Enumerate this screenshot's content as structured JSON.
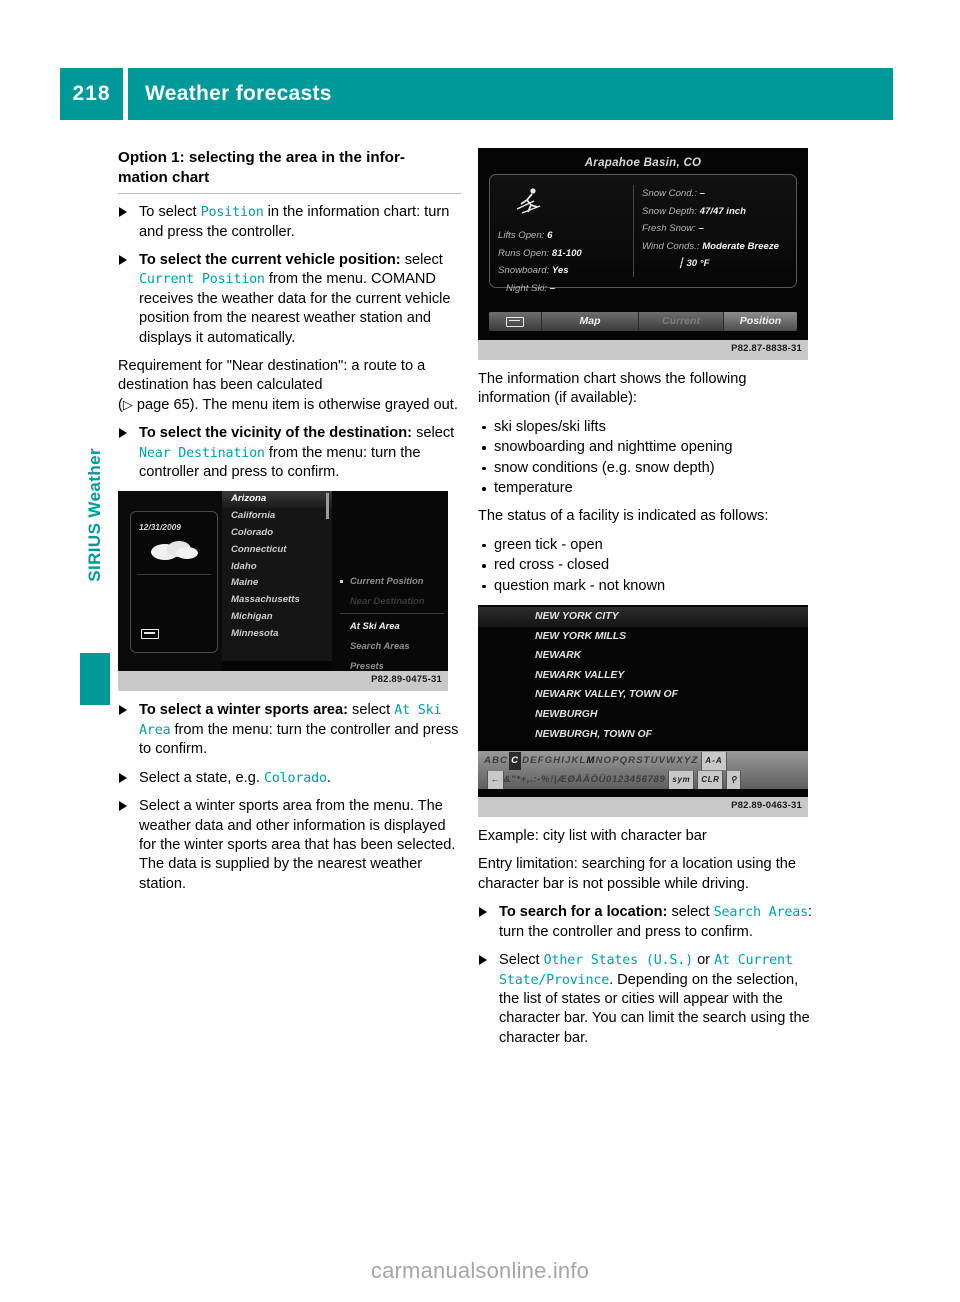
{
  "header": {
    "page_number": "218",
    "title": "Weather forecasts",
    "accent_color": "#009999"
  },
  "side_tab": {
    "label": "SIRIUS Weather"
  },
  "left_column": {
    "heading": "Option 1: selecting the area in the infor-mation chart",
    "steps": [
      {
        "id": "step-select-position",
        "lead": "",
        "text_before": "To select ",
        "mono_1": "Position",
        "text_after": " in the information chart: turn and press the controller."
      },
      {
        "id": "step-current-vehicle-position",
        "bold_lead": "To select the current vehicle position:",
        "text_before": "select ",
        "mono_1": "Current Position",
        "text_after": " from the menu. COMAND receives the weather data for the current vehicle position from the nearest weather station and displays it automatically."
      }
    ],
    "requirement_paragraph_1": "Requirement for \"Near destination\": a route to a destination has been calculated",
    "requirement_paragraph_2_arrow": "▷",
    "requirement_paragraph_2": " page 65). The menu item is otherwise grayed out.",
    "requirement_paren_open": "(",
    "step_vicinity": {
      "bold_lead": "To select the vicinity of the destination:",
      "text_before": "select ",
      "mono_1": "Near Destination",
      "text_after": " from the menu: turn the controller and press to confirm."
    },
    "step_winter_sports": {
      "bold_lead": "To select a winter sports area:",
      "text_before": " select ",
      "mono_1": "At Ski Area",
      "text_after": " from the menu: turn the controller and press to confirm."
    },
    "step_select_state": {
      "text_before": "Select a state, e.g. ",
      "mono_1": "Colorado",
      "text_after": "."
    },
    "step_select_area": {
      "text": "Select a winter sports area from the menu. The weather data and other information is displayed for the winter sports area that has been selected. The data is supplied by the nearest weather station."
    }
  },
  "right_column": {
    "intro": "The information chart shows the following information (if available):",
    "info_list": [
      "ski slopes/ski lifts",
      "snowboarding and nighttime opening",
      "snow conditions (e.g. snow depth)",
      "temperature"
    ],
    "status_intro": "The status of a facility is indicated as follows:",
    "status_list": [
      "green tick - open",
      "red cross - closed",
      "question mark - not known"
    ],
    "example_caption": "Example: city list with character bar",
    "entry_limitation": "Entry limitation: searching for a location using the character bar is not possible while driving.",
    "step_search_location": {
      "bold_lead": "To search for a location:",
      "text_before": " select ",
      "mono_1": "Search Areas",
      "text_after": ": turn the controller and press to confirm."
    },
    "step_select_states": {
      "text_before": "Select ",
      "mono_1": "Other States (U.S.)",
      "text_mid": " or ",
      "mono_2": "At Current State/Province",
      "text_after": ". Depending on the selection, the list of states or cities will appear with the character bar. You can limit the search using the character bar."
    }
  },
  "shot_info_chart": {
    "code": "P82.87-8838-31",
    "title": "Arapahoe Basin, CO",
    "left_rows": [
      {
        "label": "Lifts Open:",
        "value": "6"
      },
      {
        "label": "Runs Open:",
        "value": "81-100"
      },
      {
        "label": "Snowboard:",
        "value": "Yes"
      },
      {
        "label": "Night Ski:",
        "value": "–"
      }
    ],
    "right_rows": [
      {
        "label": "Snow Cond.:",
        "value": "–"
      },
      {
        "label": "Snow Depth:",
        "value": "47/47 inch"
      },
      {
        "label": "Fresh Snow:",
        "value": "–"
      },
      {
        "label": "Wind Conds.:",
        "value": "Moderate Breeze"
      }
    ],
    "temperature": "30 °F",
    "temperature_icon": "thermometer",
    "bottom_bar": {
      "back": "back-icon",
      "map": "Map",
      "current": "Current",
      "position": "Position"
    }
  },
  "shot_state_list": {
    "code": "P82.89-0475-31",
    "date": "12/31/2009",
    "weather_icon": "cloud-icon",
    "states": [
      "Arizona",
      "California",
      "Colorado",
      "Connecticut",
      "Idaho",
      "Maine",
      "Massachusetts",
      "Michigan",
      "Minnesota"
    ],
    "selected_state": "Arizona",
    "menu": [
      {
        "label": "Current Position",
        "state": "dim",
        "dot": true
      },
      {
        "label": "Near Destination",
        "state": "grayed",
        "dot": false
      },
      {
        "label": "At Ski Area",
        "state": "bright",
        "dot": false
      },
      {
        "label": "Search Areas",
        "state": "dim",
        "dot": false
      },
      {
        "label": "Presets",
        "state": "dim",
        "dot": false
      }
    ]
  },
  "shot_city_list": {
    "code": "P82.89-0463-31",
    "cities": [
      "NEW YORK CITY",
      "NEW YORK MILLS",
      "NEWARK",
      "NEWARK VALLEY",
      "NEWARK VALLEY, TOWN OF",
      "NEWBURGH",
      "NEWBURGH, TOWN OF"
    ],
    "selected_city": "NEW YORK CITY",
    "char_bar_row1_prefix": "ABC",
    "char_bar_row1_highlight": "C",
    "char_bar_row1": "DEFGHIJKL",
    "char_bar_row1_bold": "M",
    "char_bar_row1_rest": "NOPQRSTUVWXYZ",
    "char_bar_row1_key": "A-A",
    "char_bar_row2": "&\"*+,.:-%!|ÆØÅÄÖÜ0123456789",
    "char_bar_row2_key1": "sym",
    "char_bar_row2_key2": "CLR",
    "char_bar_row2_search": "search-icon"
  },
  "watermark": "carmanualsonline.info"
}
